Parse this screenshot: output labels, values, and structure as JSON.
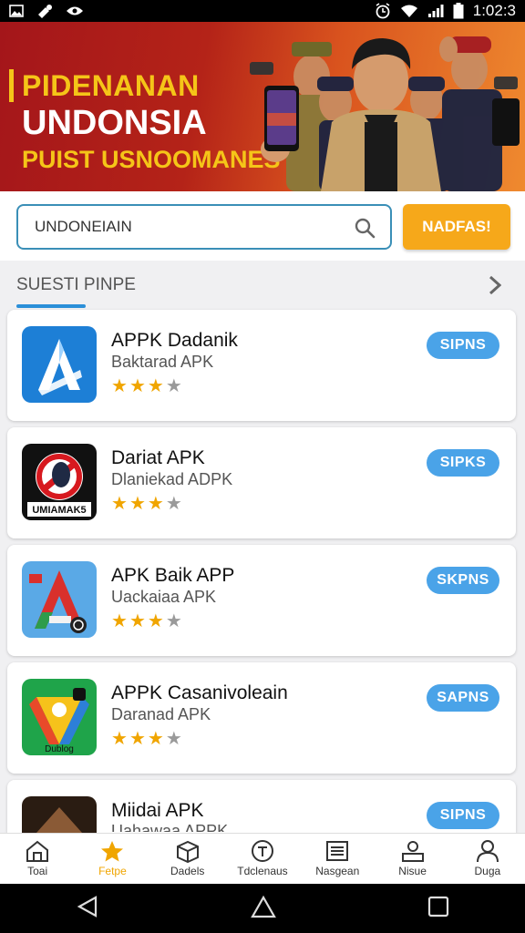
{
  "status_bar": {
    "time": "1:02:3",
    "icons": [
      "gallery-icon",
      "settings-icon",
      "eye-icon",
      "alarm-icon",
      "wifi-icon",
      "signal-icon",
      "battery-icon"
    ]
  },
  "banner": {
    "line1": "PIDENANAN",
    "line2": "UNDONSIA",
    "line3": "PUIST USNOOMANES",
    "colors": {
      "accent": "#f5c518",
      "background": "#b42318"
    }
  },
  "search": {
    "value": "UNDONEIAIN",
    "placeholder": "",
    "button_label": "NADFAS!"
  },
  "section": {
    "title": "SUESTI PINPE"
  },
  "apps": [
    {
      "name": "APPK Dadanik",
      "subtitle": "Baktarad APK",
      "rating": 3,
      "max_rating": 4,
      "button": "SIPNS",
      "icon_name": "blue-a-app-icon"
    },
    {
      "name": "Dariat APK",
      "subtitle": "Dlaniekad ADPK",
      "rating": 3,
      "max_rating": 4,
      "button": "SIPKS",
      "icon_name": "red-circle-app-icon",
      "icon_text": "UMIAMAK5"
    },
    {
      "name": "APK Baik APP",
      "subtitle": "Uackaiaa APK",
      "rating": 3,
      "max_rating": 4,
      "button": "SKPNS",
      "icon_name": "tricolor-a-app-icon"
    },
    {
      "name": "APPK Casanivoleain",
      "subtitle": "Daranad APK",
      "rating": 3,
      "max_rating": 4,
      "button": "SAPNS",
      "icon_name": "green-triangle-app-icon",
      "icon_text": "Dublog"
    },
    {
      "name": "Miidai APK",
      "subtitle": "Uahawaa APPK",
      "button": "SIPNS",
      "icon_name": "dark-app-icon"
    }
  ],
  "bottom_nav": [
    {
      "label": "Toai",
      "icon": "home-icon",
      "active": false
    },
    {
      "label": "Fetpe",
      "icon": "star-icon",
      "active": true
    },
    {
      "label": "Dadels",
      "icon": "box-icon",
      "active": false
    },
    {
      "label": "Tdclenaus",
      "icon": "badge-icon",
      "active": false
    },
    {
      "label": "Nasgean",
      "icon": "list-icon",
      "active": false
    },
    {
      "label": "Nisue",
      "icon": "inbox-user-icon",
      "active": false
    },
    {
      "label": "Duga",
      "icon": "user-icon",
      "active": false
    }
  ],
  "system_nav": [
    "back-icon",
    "home-icon",
    "recents-icon"
  ]
}
